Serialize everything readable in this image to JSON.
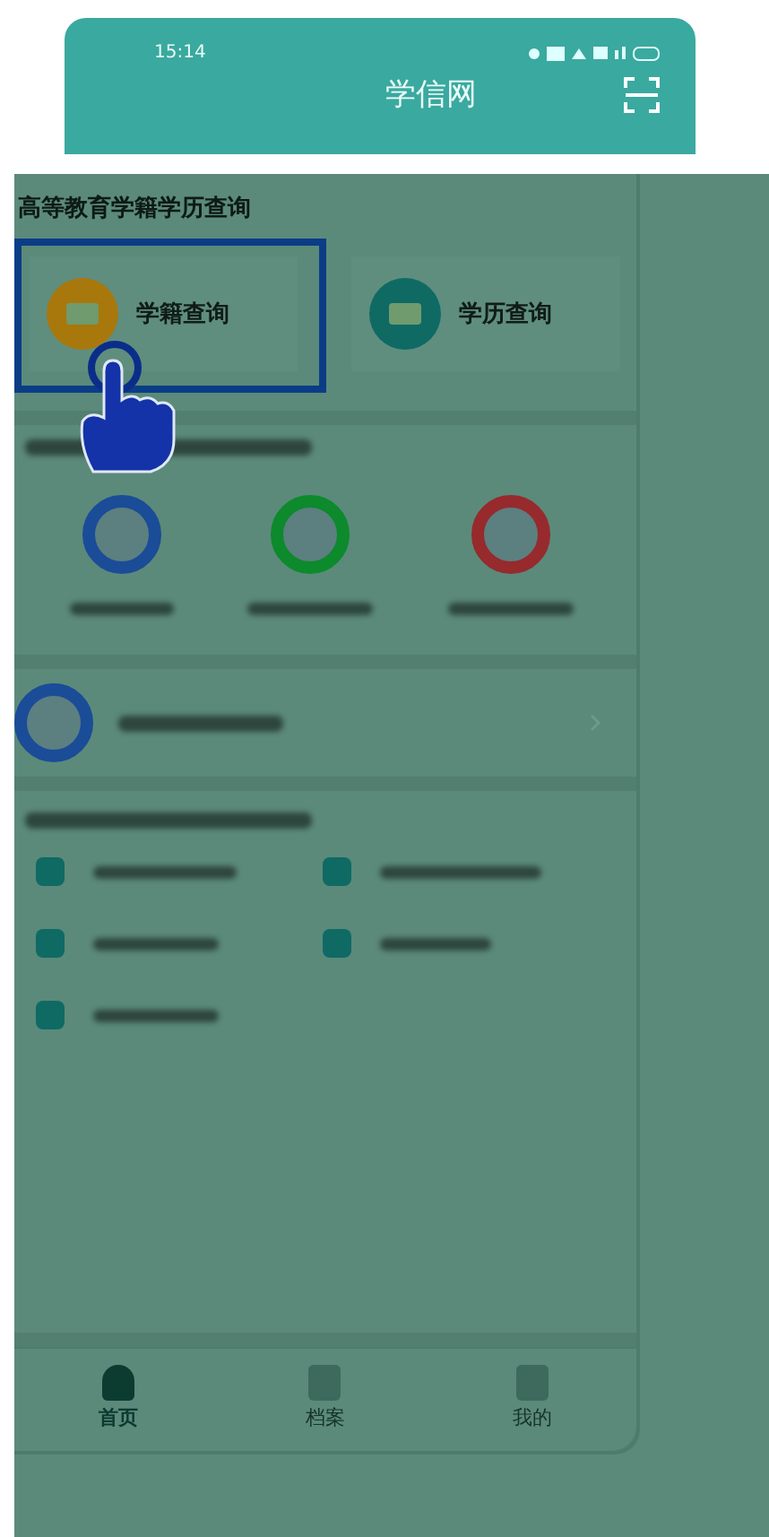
{
  "status_bar": {
    "time": "15:14"
  },
  "header": {
    "title": "学信网"
  },
  "query_section": {
    "title": "高等教育学籍学历查询",
    "tiles": [
      {
        "label": "学籍查询",
        "color": "#a8780c",
        "highlighted": true
      },
      {
        "label": "学历查询",
        "color": "#0f6a64",
        "highlighted": false
      }
    ]
  },
  "service_icons": [
    {
      "color": "#1a4c98"
    },
    {
      "color": "#0c8a2c"
    },
    {
      "color": "#962a2c"
    }
  ],
  "link_row": {
    "color": "#1a4c98"
  },
  "list_items": [
    {
      "color": "#0f6a64"
    },
    {
      "color": "#0f6a64"
    },
    {
      "color": "#0f6a64"
    },
    {
      "color": "#0f6a64"
    },
    {
      "color": "#0f6a64"
    }
  ],
  "bottom_nav": [
    {
      "label": "首页",
      "selected": true
    },
    {
      "label": "档案",
      "selected": false
    },
    {
      "label": "我的",
      "selected": false
    }
  ]
}
